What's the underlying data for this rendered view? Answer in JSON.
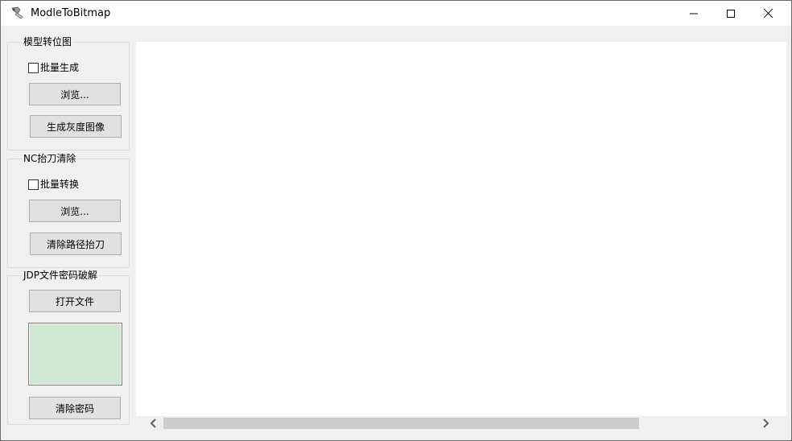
{
  "window": {
    "title": "ModleToBitmap",
    "icon": "app-icon",
    "controls": {
      "minimize": "minimize-icon",
      "maximize": "maximize-icon",
      "close": "close-icon"
    }
  },
  "groups": {
    "model_to_bitmap": {
      "title": "模型转位图",
      "batch_label": "批量生成",
      "batch_checked": false,
      "browse_label": "浏览...",
      "generate_label": "生成灰度图像"
    },
    "nc_cleanup": {
      "title": "NC抬刀清除",
      "batch_label": "批量转换",
      "batch_checked": false,
      "browse_label": "浏览...",
      "clear_label": "清除路径抬刀"
    },
    "jdp_crack": {
      "title": "JDP文件密码破解",
      "open_label": "打开文件",
      "password_value": "",
      "clear_label": "清除密码"
    }
  },
  "scrollbar": {
    "left_icon": "chevron-left-icon",
    "right_icon": "chevron-right-icon",
    "position": 0.0,
    "visible_fraction": 0.78
  },
  "colors": {
    "password_box_bg": "#cfe6d0",
    "button_bg": "#e1e1e1",
    "window_bg": "#f0f0f0"
  }
}
